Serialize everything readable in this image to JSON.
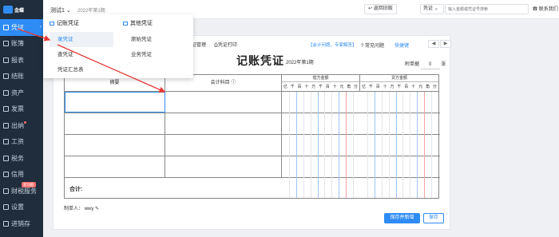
{
  "sidebar": {
    "logo_text": "金蝶",
    "items": [
      {
        "label": "凭证",
        "active": true
      },
      {
        "label": "账簿"
      },
      {
        "label": "报表"
      },
      {
        "label": "结账"
      },
      {
        "label": "资产"
      },
      {
        "label": "发票"
      },
      {
        "label": "出纳"
      },
      {
        "label": "工资"
      },
      {
        "label": "税务"
      },
      {
        "label": "信用"
      },
      {
        "label": "财税服务",
        "badge": "新功能"
      },
      {
        "label": "设置"
      },
      {
        "label": "进销存"
      }
    ]
  },
  "topbar": {
    "account": "测试1",
    "period": "2022年第1期",
    "back_button": "返回旧版",
    "search_type": "凭证",
    "search_placeholder": "输入金额或凭证号搜索",
    "contact": "联系我们"
  },
  "dropdown": {
    "left_header": "记账凭证",
    "left_items": [
      "录凭证",
      "查凭证",
      "凭证汇总表"
    ],
    "right_header": "其他凭证",
    "right_items": [
      "原始凭证",
      "业务凭证"
    ]
  },
  "voucher_toolbar": {
    "template_mgmt": "证管理",
    "print": "凭证打印",
    "help_link": "【会计问题，专家解答】",
    "common_questions": "常见问题",
    "shortcut": "快捷键",
    "prev": "◀",
    "next": "▶"
  },
  "voucher": {
    "title": "记账凭证",
    "period": "2022年第1期",
    "attachments_label": "附单据",
    "attachments_value": "0",
    "attachments_unit": "张",
    "col_summary": "摘要",
    "col_account": "会计科目",
    "col_debit": "借方金额",
    "col_credit": "贷方金额",
    "units": [
      "亿",
      "千",
      "百",
      "十",
      "万",
      "千",
      "百",
      "十",
      "元",
      "角",
      "分"
    ],
    "total_label": "合计:",
    "maker_label": "制单人：",
    "maker_value": "wwy",
    "save_new": "保存并新增",
    "save": "保存"
  },
  "colors": {
    "sidebar_bg": "#1f2d3d",
    "accent": "#2f8cf4",
    "arrow": "#e53935"
  }
}
